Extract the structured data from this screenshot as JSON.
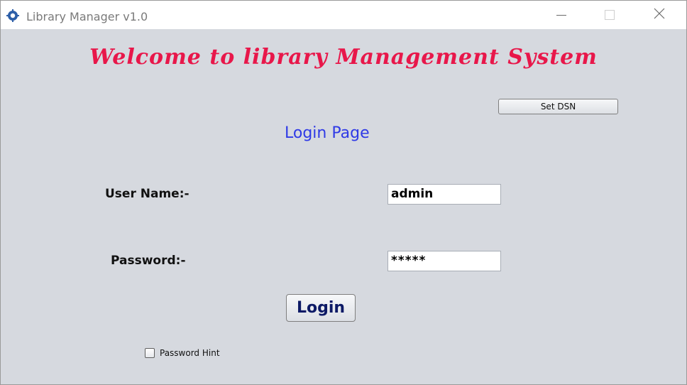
{
  "window": {
    "title": "Library Manager v1.0",
    "icon": "gear-icon"
  },
  "header": {
    "title": "Welcome to library Management System"
  },
  "toolbar": {
    "set_dsn_label": "Set DSN"
  },
  "page": {
    "subtitle": "Login Page"
  },
  "form": {
    "username_label": "User Name:-",
    "username_value": "admin",
    "password_label": "Password:-",
    "password_value": "*****",
    "login_label": "Login",
    "hint_label": "Password Hint",
    "hint_checked": false
  },
  "colors": {
    "title_accent": "#e8174a",
    "subtitle_accent": "#2f3ae6",
    "login_text": "#0d1a66",
    "background": "#d6d9df"
  }
}
